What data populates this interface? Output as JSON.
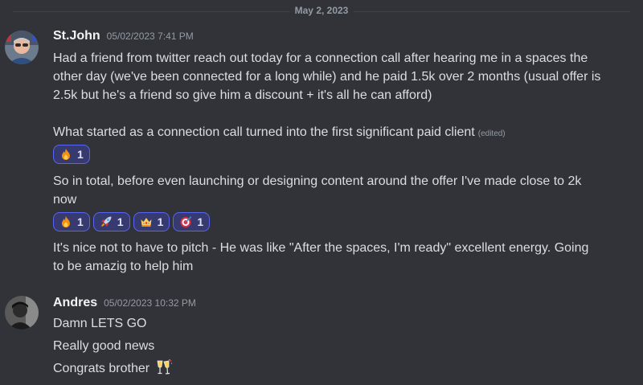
{
  "date_divider": "May 2, 2023",
  "messages": [
    {
      "username": "St.John",
      "timestamp": "05/02/2023 7:41 PM",
      "lines": [
        "Had a friend from twitter reach out today for a connection call after hearing me in a spaces the",
        "other day (we've been connected for a long while) and he paid 1.5k over 2 months (usual offer is",
        "2.5k but he's a friend so give him a discount + it's all he can afford)",
        "What started as a connection call turned into the first significant paid client",
        "So in total, before even launching or designing content around the offer I've made close to 2k",
        "now",
        "It's nice not to have to pitch - He was like \"After the spaces, I'm ready\" excellent energy.  Going",
        "to be amazig to help him"
      ],
      "edited_label": "(edited)",
      "reactions_1": [
        {
          "icon": "fire-emoji-icon",
          "count": "1"
        }
      ],
      "reactions_2": [
        {
          "icon": "fire-emoji-icon",
          "count": "1"
        },
        {
          "icon": "rocket-emoji-icon",
          "count": "1"
        },
        {
          "icon": "crown-emoji-icon",
          "count": "1"
        },
        {
          "icon": "target-emoji-icon",
          "count": "1"
        }
      ]
    },
    {
      "username": "Andres",
      "timestamp": "05/02/2023 10:32 PM",
      "lines": [
        "Damn LETS GO",
        "Really good news",
        "Congrats brother"
      ],
      "emoji": "champagne-glasses-icon"
    }
  ],
  "colors": {
    "background": "#313338",
    "reaction_bg": "#373a6e",
    "reaction_border": "#5865f2"
  }
}
